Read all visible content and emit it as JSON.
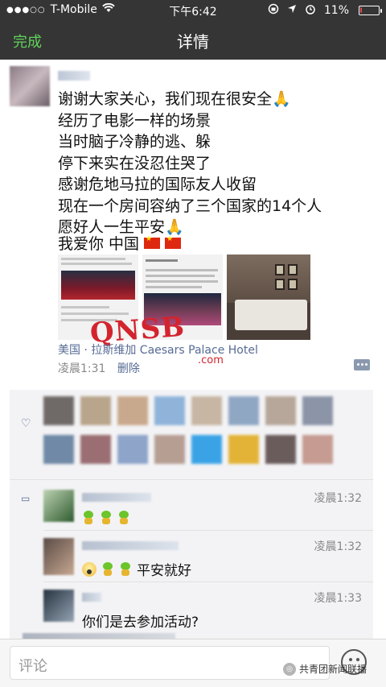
{
  "status_bar": {
    "carrier": "T-Mobile",
    "time": "下午6:42",
    "battery_percent": "11%",
    "battery_level": 0.11
  },
  "nav": {
    "done_label": "完成",
    "title": "详情"
  },
  "post": {
    "lines": "谢谢大家关心，我们现在很安全🙏\n经历了电影一样的场景\n当时脑子冷静的逃、躲\n停下来实在没忍住哭了\n感谢危地马拉的国际友人收留\n现在一个房间容纳了三个国家的14个人\n愿好人一生平安🙏",
    "tail": "我爱你  中国",
    "location": "美国 · 拉斯维加 Caesars Palace Hotel",
    "time": "凌晨1:31",
    "delete_label": "删除",
    "watermark": "QNSB",
    "watermark_sub": ".com"
  },
  "comments": [
    {
      "time": "凌晨1:32",
      "text": ""
    },
    {
      "time": "凌晨1:32",
      "text": "平安就好"
    },
    {
      "time": "凌晨1:33",
      "text": "你们是去参加活动?"
    }
  ],
  "input": {
    "placeholder": "评论"
  },
  "brand": {
    "label": "共青团新闻联播"
  },
  "colors": {
    "bar": "#353535",
    "accent_green": "#5fd35a",
    "link_blue": "#576b95",
    "watermark_red": "#d3242e"
  }
}
